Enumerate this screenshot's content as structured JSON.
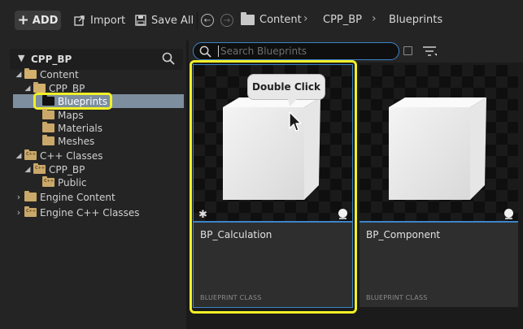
{
  "toolbar": {
    "add_label": "ADD",
    "import_label": "Import",
    "save_all_label": "Save All",
    "breadcrumb": [
      "Content",
      "CPP_BP",
      "Blueprints"
    ]
  },
  "left_panel": {
    "title": "CPP_BP",
    "tree": [
      {
        "label": "Content",
        "level": 0,
        "expanded": true
      },
      {
        "label": "CPP_BP",
        "level": 1,
        "expanded": true
      },
      {
        "label": "Blueprints",
        "level": 2,
        "selected": true
      },
      {
        "label": "Maps",
        "level": 2
      },
      {
        "label": "Materials",
        "level": 2
      },
      {
        "label": "Meshes",
        "level": 2
      },
      {
        "label": "C++ Classes",
        "level": 0,
        "expanded": true,
        "cpp": true
      },
      {
        "label": "CPP_BP",
        "level": 1,
        "expanded": true,
        "cpp": true
      },
      {
        "label": "Public",
        "level": 2,
        "cpp": true
      },
      {
        "label": "Engine Content",
        "level": 0,
        "expanded": false
      },
      {
        "label": "Engine C++ Classes",
        "level": 0,
        "expanded": false,
        "cpp": true
      }
    ]
  },
  "search": {
    "placeholder": "Search Blueprints"
  },
  "assets": [
    {
      "name": "BP_Calculation",
      "class_label": "BLUEPRINT CLASS",
      "selected": true,
      "modified": true
    },
    {
      "name": "BP_Component",
      "class_label": "BLUEPRINT CLASS",
      "selected": false,
      "modified": false
    }
  ],
  "tooltip": {
    "text": "Double Click"
  },
  "colors": {
    "highlight": "#f1f026",
    "accent_blue": "#3d84c8",
    "folder": "#c9a86a"
  }
}
